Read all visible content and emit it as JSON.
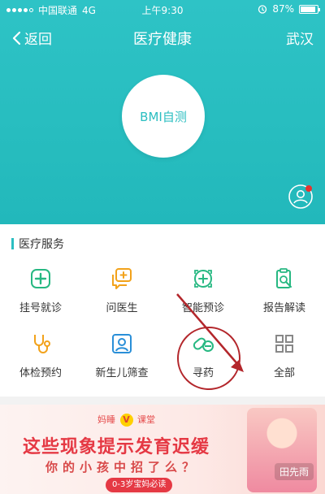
{
  "status_bar": {
    "carrier": "中国联通",
    "network": "4G",
    "time": "上午9:30",
    "battery": "87%"
  },
  "nav": {
    "back_label": "返回",
    "title": "医疗健康",
    "city": "武汉"
  },
  "hero": {
    "bmi_label": "BMI自测"
  },
  "services": {
    "title": "医疗服务",
    "items": [
      {
        "label": "挂号就诊",
        "icon": "hospital-cross-icon"
      },
      {
        "label": "问医生",
        "icon": "chat-doctor-icon"
      },
      {
        "label": "智能预诊",
        "icon": "smart-diagnosis-icon"
      },
      {
        "label": "报告解读",
        "icon": "report-icon"
      },
      {
        "label": "体检预约",
        "icon": "stethoscope-icon"
      },
      {
        "label": "新生儿筛查",
        "icon": "newborn-screen-icon"
      },
      {
        "label": "寻药",
        "icon": "pill-icon"
      },
      {
        "label": "全部",
        "icon": "grid-icon"
      }
    ]
  },
  "banner": {
    "brand": "妈睡",
    "brand_v": "V",
    "brand_suffix": "课堂",
    "headline": "这些现象提示发育迟缓",
    "subhead": "你的小孩中招了么？",
    "pill": "0-3岁宝妈必读",
    "sign": "田先雨"
  },
  "colors": {
    "teal": "#2bbec1",
    "orange": "#f2a21b",
    "green": "#27b882",
    "banner_red": "#e53944"
  }
}
